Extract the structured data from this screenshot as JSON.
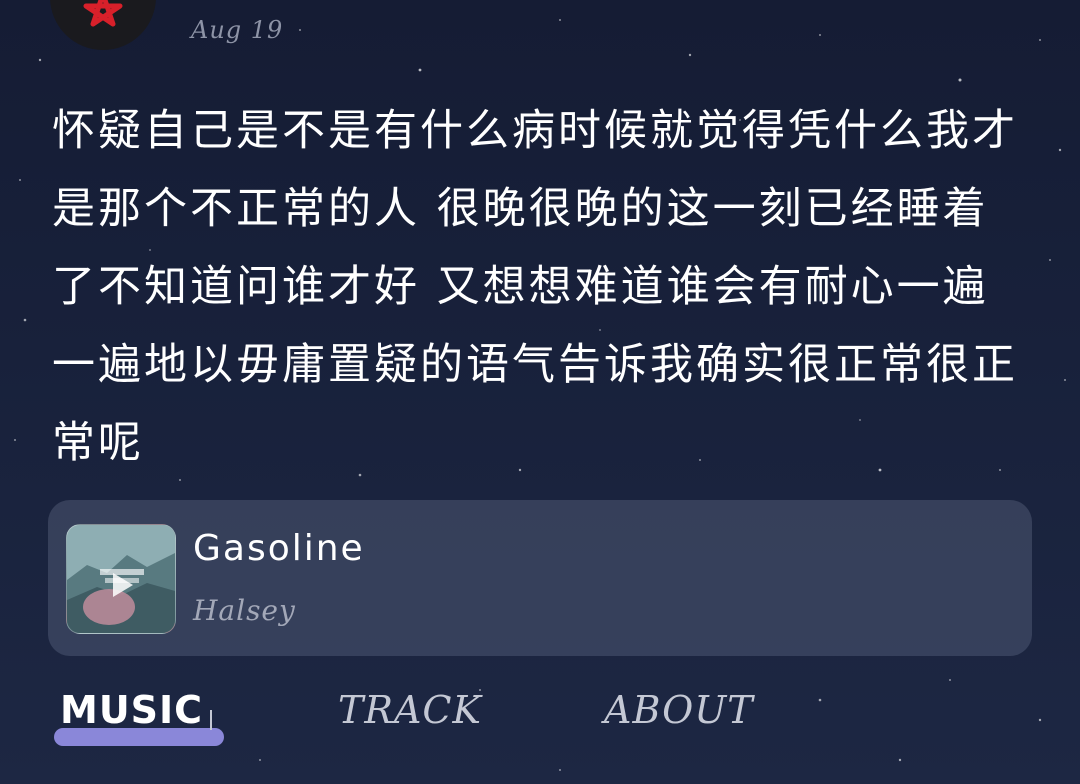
{
  "post": {
    "date": "Aug 19",
    "text": "怀疑自己是不是有什么病时候就觉得凭什么我才是那个不正常的人 很晚很晚的这一刻已经睡着了不知道问谁才好 又想想难道谁会有耐心一遍一遍地以毋庸置疑的语气告诉我确实很正常很正常呢"
  },
  "music_card": {
    "title": "Gasoline",
    "artist": "Halsey",
    "album_icon": "album-cover-badlands"
  },
  "tabs": [
    {
      "label": "MUSIC",
      "active": true
    },
    {
      "label": "TRACK",
      "active": false
    },
    {
      "label": "ABOUT",
      "active": false
    }
  ],
  "colors": {
    "background": "#18213b",
    "accent": "#8a87d9",
    "avatar_star": "#d8202a",
    "muted_text": "#8d93a6"
  }
}
